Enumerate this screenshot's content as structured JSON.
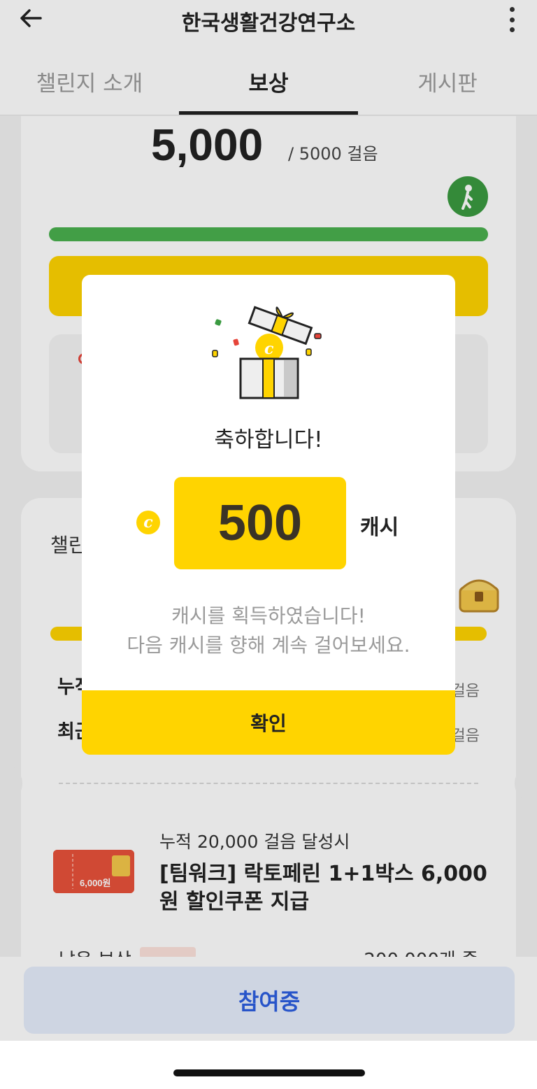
{
  "header": {
    "title": "한국생활건강연구소",
    "back_icon": "arrow-left-icon",
    "more_icon": "more-vertical-icon"
  },
  "tabs": [
    {
      "label": "챌린지 소개",
      "active": false
    },
    {
      "label": "보상",
      "active": true
    },
    {
      "label": "게시판",
      "active": false
    }
  ],
  "steps": {
    "current": "5,000",
    "goal": "/ 5000 걸음",
    "progress": 1.0
  },
  "challenge": {
    "label": "챌린",
    "row1_label": "누적",
    "row1_unit": "걸음",
    "row2_label": "최근",
    "row2_unit": "걸음",
    "progress": 1.0
  },
  "reward": {
    "condition": "누적 20,000 걸음 달성시",
    "name": "[팀워크] 락토페린 1+1박스 6,000원 할인쿠폰 지급",
    "coupon_amount": "6,000원",
    "partial_left": "남은 보상",
    "partial_right": "200,000개 중"
  },
  "bottom": {
    "join_label": "참여중"
  },
  "modal": {
    "congrats": "축하합니다!",
    "coin_symbol": "c",
    "amount": "500",
    "unit": "캐시",
    "message_line1": "캐시를 획득하였습니다!",
    "message_line2": "다음 캐시를 향해 계속 걸어보세요.",
    "confirm_label": "확인"
  },
  "colors": {
    "accent_yellow": "#ffd400",
    "progress_green": "#4ab04f",
    "join_text": "#2c5ee0",
    "join_bg": "#e6eefc"
  }
}
